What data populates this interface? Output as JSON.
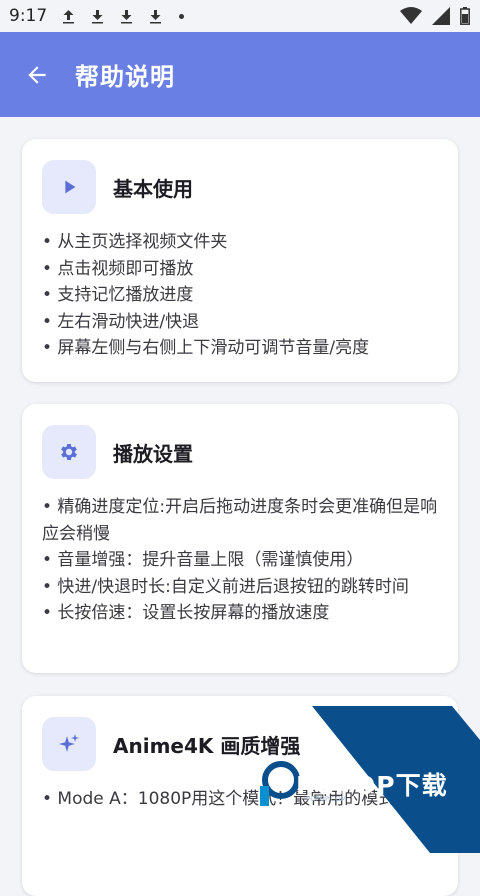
{
  "status_bar": {
    "time": "9:17",
    "icons": [
      "upload-icon",
      "download-icon",
      "download-icon",
      "download-icon",
      "dot-icon",
      "wifi-icon",
      "signal-icon",
      "battery-icon"
    ]
  },
  "app_bar": {
    "title": "帮助说明",
    "background": "#6a7fe4"
  },
  "cards": [
    {
      "icon": "play-icon",
      "title": "基本使用",
      "items": [
        "• 从主页选择视频文件夹",
        "• 点击视频即可播放",
        "• 支持记忆播放进度",
        "• 左右滑动快进/快退",
        "• 屏幕左侧与右侧上下滑动可调节音量/亮度"
      ]
    },
    {
      "icon": "gear-icon",
      "title": "播放设置",
      "items": [
        "• 精确进度定位:开启后拖动进度条时会更准确但是响应会稍慢",
        "• 音量增强：提升音量上限（需谨慎使用）",
        "• 快进/快退时长:自定义前进后退按钮的跳转时间",
        "• 长按倍速：设置长按屏幕的播放速度"
      ]
    },
    {
      "icon": "sparkle-icon",
      "title": "Anime4K 画质增强",
      "items": [
        "• Mode A：1080P用这个模式！最常用的模式！"
      ]
    }
  ],
  "watermark": {
    "text": "PCPOP下载",
    "sub": "PCPOP.COM"
  },
  "colors": {
    "accent": "#6a7fe4",
    "icon_bg": "#e6e9fb",
    "watermark_blue": "#0a4f8c"
  }
}
